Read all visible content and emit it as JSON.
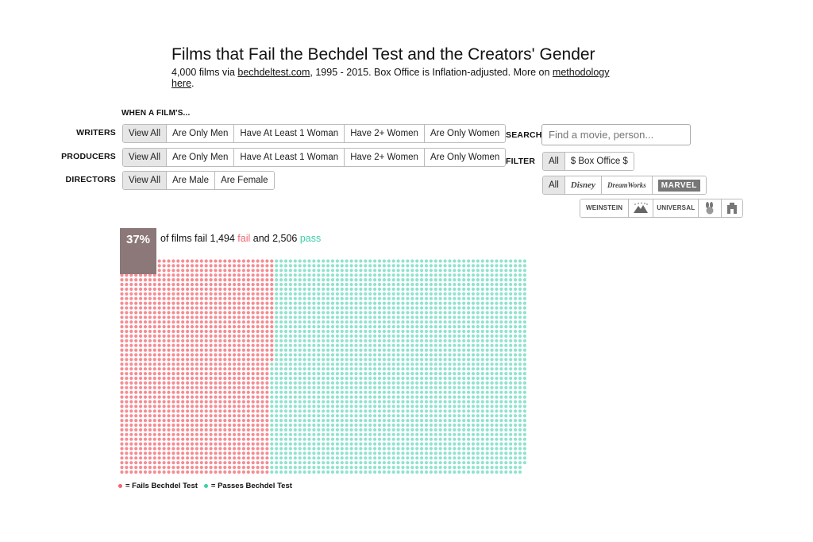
{
  "header": {
    "title": "Films that Fail the Bechdel Test and the Creators' Gender",
    "sub_prefix": "4,000 films via ",
    "sub_link": "bechdeltest.com",
    "sub_middle": ", 1995 - 2015. Box Office is Inflation-adjusted. More on ",
    "sub_link2": "methodology",
    "sub_link3": "here",
    "sub_end": "."
  },
  "filters": {
    "when_label": "WHEN A FILM'S...",
    "writers": {
      "label": "WRITERS",
      "options": [
        "View All",
        "Are Only Men",
        "Have At Least 1 Woman",
        "Have 2+ Women",
        "Are Only Women"
      ]
    },
    "producers": {
      "label": "PRODUCERS",
      "options": [
        "View All",
        "Are Only Men",
        "Have At Least 1 Woman",
        "Have 2+ Women",
        "Are Only Women"
      ]
    },
    "directors": {
      "label": "DIRECTORS",
      "options": [
        "View All",
        "Are Male",
        "Are Female"
      ]
    }
  },
  "search": {
    "label": "SEARCH",
    "placeholder": "Find a movie, person..."
  },
  "filter": {
    "label": "FILTER",
    "all_label": "All",
    "box_office_label": "$ Box Office $",
    "studios_all_label": "All",
    "studios_row1": [
      "Disney",
      "DreamWorks",
      "MARVEL"
    ],
    "studios_row2": [
      "WEINSTEIN",
      "Paramount",
      "UNIVERSAL",
      "Warner",
      "Lionsgate"
    ]
  },
  "summary": {
    "percent": "37%",
    "text_a": "of films fail ",
    "fail_count": "1,494",
    "fail_word": "fail",
    "text_b": " and ",
    "pass_count": "2,506",
    "pass_word": "pass"
  },
  "legend": {
    "fail_label": "= Fails Bechdel Test",
    "pass_label": "= Passes Bechdel Test"
  },
  "chart_data": {
    "type": "waffle",
    "fail": 1494,
    "pass": 2506,
    "fail_color": "#f58c92",
    "pass_color": "#8fe3ce",
    "highlight_color": "#8c7878"
  }
}
